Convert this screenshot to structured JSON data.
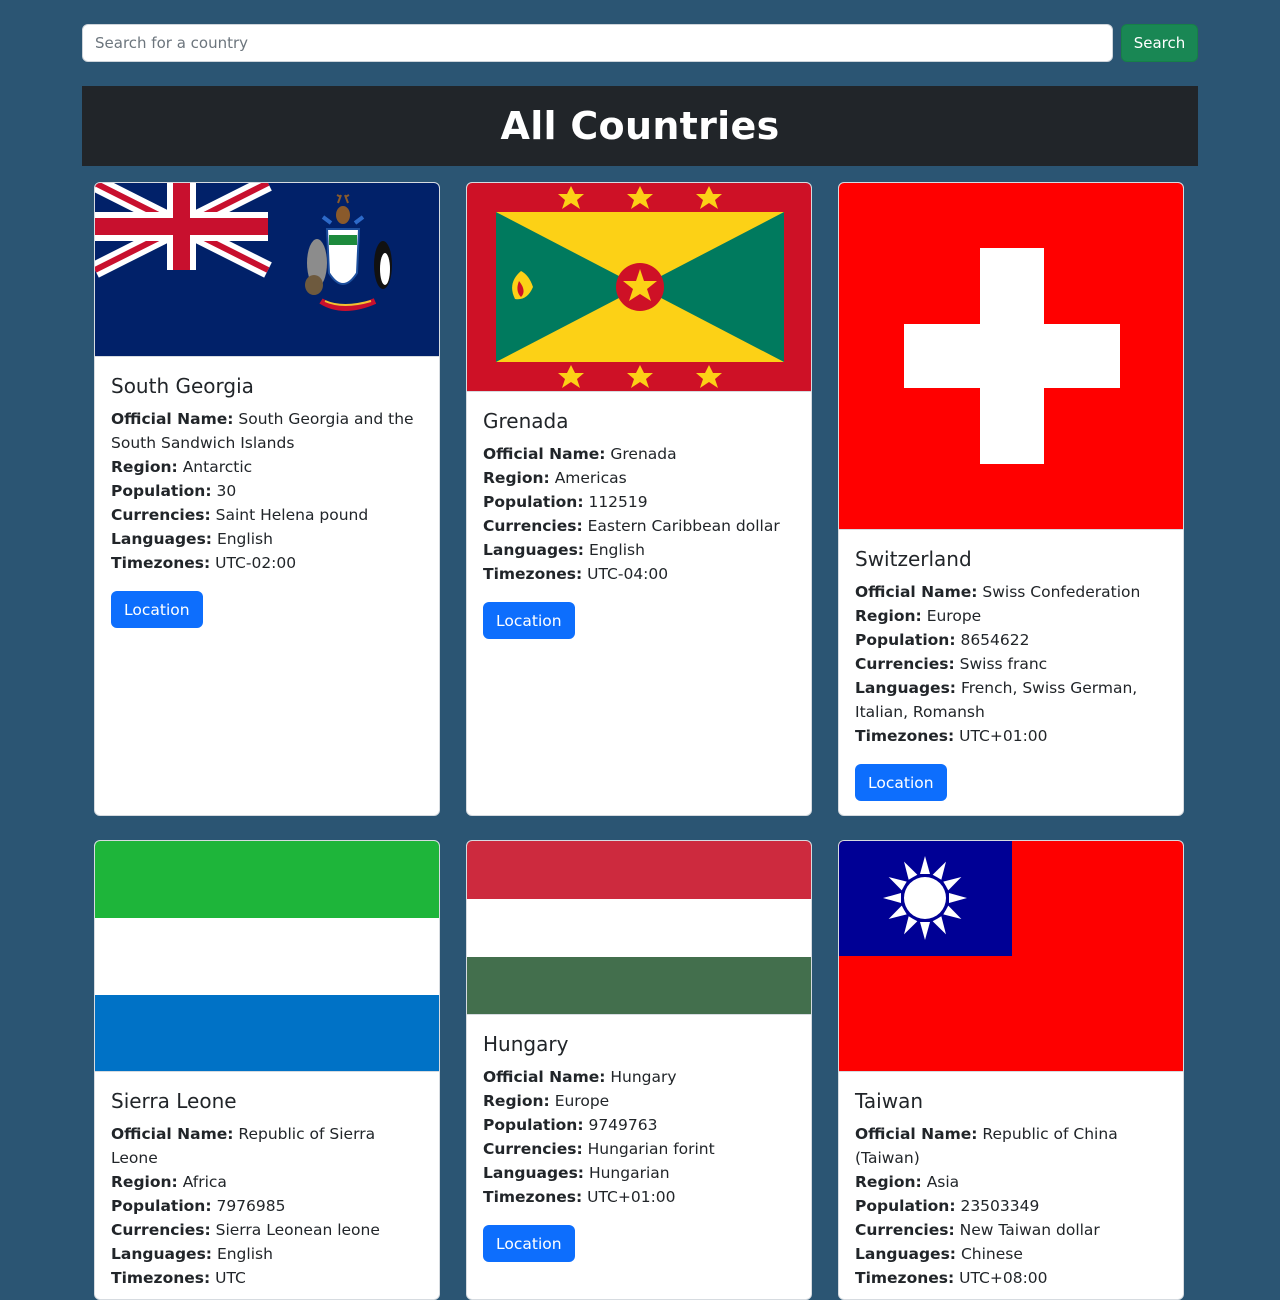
{
  "search": {
    "placeholder": "Search for a country",
    "button_label": "Search"
  },
  "header": {
    "title": "All Countries"
  },
  "labels": {
    "official_name": "Official Name:",
    "region": "Region:",
    "population": "Population:",
    "currencies": "Currencies:",
    "languages": "Languages:",
    "timezones": "Timezones:",
    "location": "Location"
  },
  "countries": [
    {
      "name": "South Georgia",
      "official_name": "South Georgia and the South Sandwich Islands",
      "region": "Antarctic",
      "population": "30",
      "currencies": "Saint Helena pound",
      "languages": "English",
      "timezones": "UTC-02:00",
      "flag_icon": "flag-south-georgia-icon"
    },
    {
      "name": "Grenada",
      "official_name": "Grenada",
      "region": "Americas",
      "population": "112519",
      "currencies": "Eastern Caribbean dollar",
      "languages": "English",
      "timezones": "UTC-04:00",
      "flag_icon": "flag-grenada-icon"
    },
    {
      "name": "Switzerland",
      "official_name": "Swiss Confederation",
      "region": "Europe",
      "population": "8654622",
      "currencies": "Swiss franc",
      "languages": "French, Swiss German, Italian, Romansh",
      "timezones": "UTC+01:00",
      "flag_icon": "flag-switzerland-icon"
    },
    {
      "name": "Sierra Leone",
      "official_name": "Republic of Sierra Leone",
      "region": "Africa",
      "population": "7976985",
      "currencies": "Sierra Leonean leone",
      "languages": "English",
      "timezones": "UTC",
      "flag_icon": "flag-sierra-leone-icon"
    },
    {
      "name": "Hungary",
      "official_name": "Hungary",
      "region": "Europe",
      "population": "9749763",
      "currencies": "Hungarian forint",
      "languages": "Hungarian",
      "timezones": "UTC+01:00",
      "flag_icon": "flag-hungary-icon"
    },
    {
      "name": "Taiwan",
      "official_name": "Republic of China (Taiwan)",
      "region": "Asia",
      "population": "23503349",
      "currencies": "New Taiwan dollar",
      "languages": "Chinese",
      "timezones": "UTC+08:00",
      "flag_icon": "flag-taiwan-icon"
    }
  ],
  "colors": {
    "page_background": "#2b5573",
    "header_background": "#212529",
    "search_button": "#198754",
    "location_button": "#0d6efd"
  }
}
